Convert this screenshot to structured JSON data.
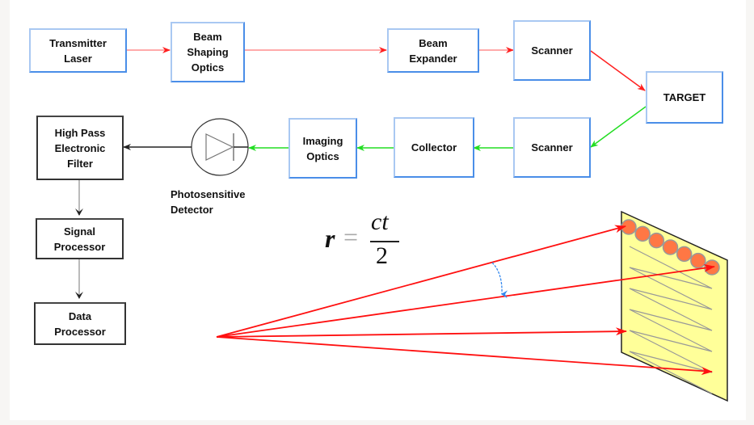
{
  "diagram": {
    "title": "",
    "blocks": {
      "transmitter_laser": "Transmitter\nLaser",
      "beam_shaping_optics": "Beam\nShaping\nOptics",
      "beam_expander": "Beam\nExpander",
      "scanner_tx": "Scanner",
      "target": "TARGET",
      "scanner_rx": "Scanner",
      "collector": "Collector",
      "imaging_optics": "Imaging\nOptics",
      "photosensitive_detector": "Photosensitive\nDetector",
      "high_pass_filter": "High Pass\nElectronic\nFilter",
      "signal_processor": "Signal\nProcessor",
      "data_processor": "Data\nProcessor"
    },
    "formula": {
      "lhs": "r",
      "equals": "=",
      "numerator": "ct",
      "denominator": "2"
    },
    "colors": {
      "transmit_path": "#ff2020",
      "receive_path": "#22dd22",
      "electronic_path": "#222222",
      "block_border_blue": "#4a8ee8",
      "target_plane": "#ffff99",
      "scan_spot": "#ff7744",
      "scan_pattern": "#999999",
      "angle_marker": "#3388ee"
    },
    "edges": [
      {
        "from": "transmitter_laser",
        "to": "beam_shaping_optics",
        "path": "transmit"
      },
      {
        "from": "beam_shaping_optics",
        "to": "beam_expander",
        "path": "transmit"
      },
      {
        "from": "beam_expander",
        "to": "scanner_tx",
        "path": "transmit"
      },
      {
        "from": "scanner_tx",
        "to": "target",
        "path": "transmit"
      },
      {
        "from": "target",
        "to": "scanner_rx",
        "path": "receive"
      },
      {
        "from": "scanner_rx",
        "to": "collector",
        "path": "receive"
      },
      {
        "from": "collector",
        "to": "imaging_optics",
        "path": "receive"
      },
      {
        "from": "imaging_optics",
        "to": "photosensitive_detector",
        "path": "receive"
      },
      {
        "from": "photosensitive_detector",
        "to": "high_pass_filter",
        "path": "electronic"
      },
      {
        "from": "high_pass_filter",
        "to": "signal_processor",
        "path": "electronic"
      },
      {
        "from": "signal_processor",
        "to": "data_processor",
        "path": "electronic"
      }
    ],
    "scan_illustration": {
      "ray_count": 4,
      "scan_spot_count": 7,
      "scan_pattern": "raster zig-zag"
    }
  }
}
